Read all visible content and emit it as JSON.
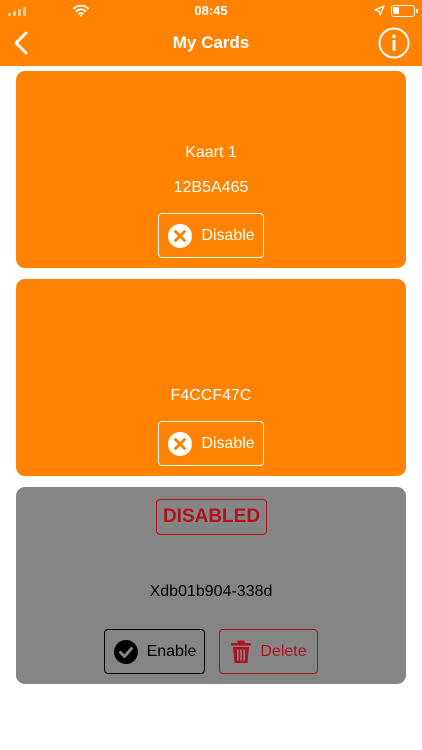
{
  "status_bar": {
    "time": "08:45"
  },
  "header": {
    "title": "My Cards"
  },
  "cards": [
    {
      "name": "Kaart 1",
      "id": "12B5A465",
      "button_label": "Disable"
    },
    {
      "name": "",
      "id": "F4CCF47C",
      "button_label": "Disable"
    },
    {
      "status_badge": "DISABLED",
      "id": "Xdb01b904-338d",
      "enable_label": "Enable",
      "delete_label": "Delete"
    }
  ],
  "colors": {
    "brand_orange": "#FF8300",
    "disabled_card": "#858585",
    "danger_red": "#B0131B"
  },
  "icons": [
    "back-chevron-icon",
    "info-icon",
    "cancel-circle-icon",
    "check-circle-icon",
    "trash-icon",
    "wifi-icon",
    "location-arrow-icon",
    "battery-icon",
    "signal-icon"
  ]
}
